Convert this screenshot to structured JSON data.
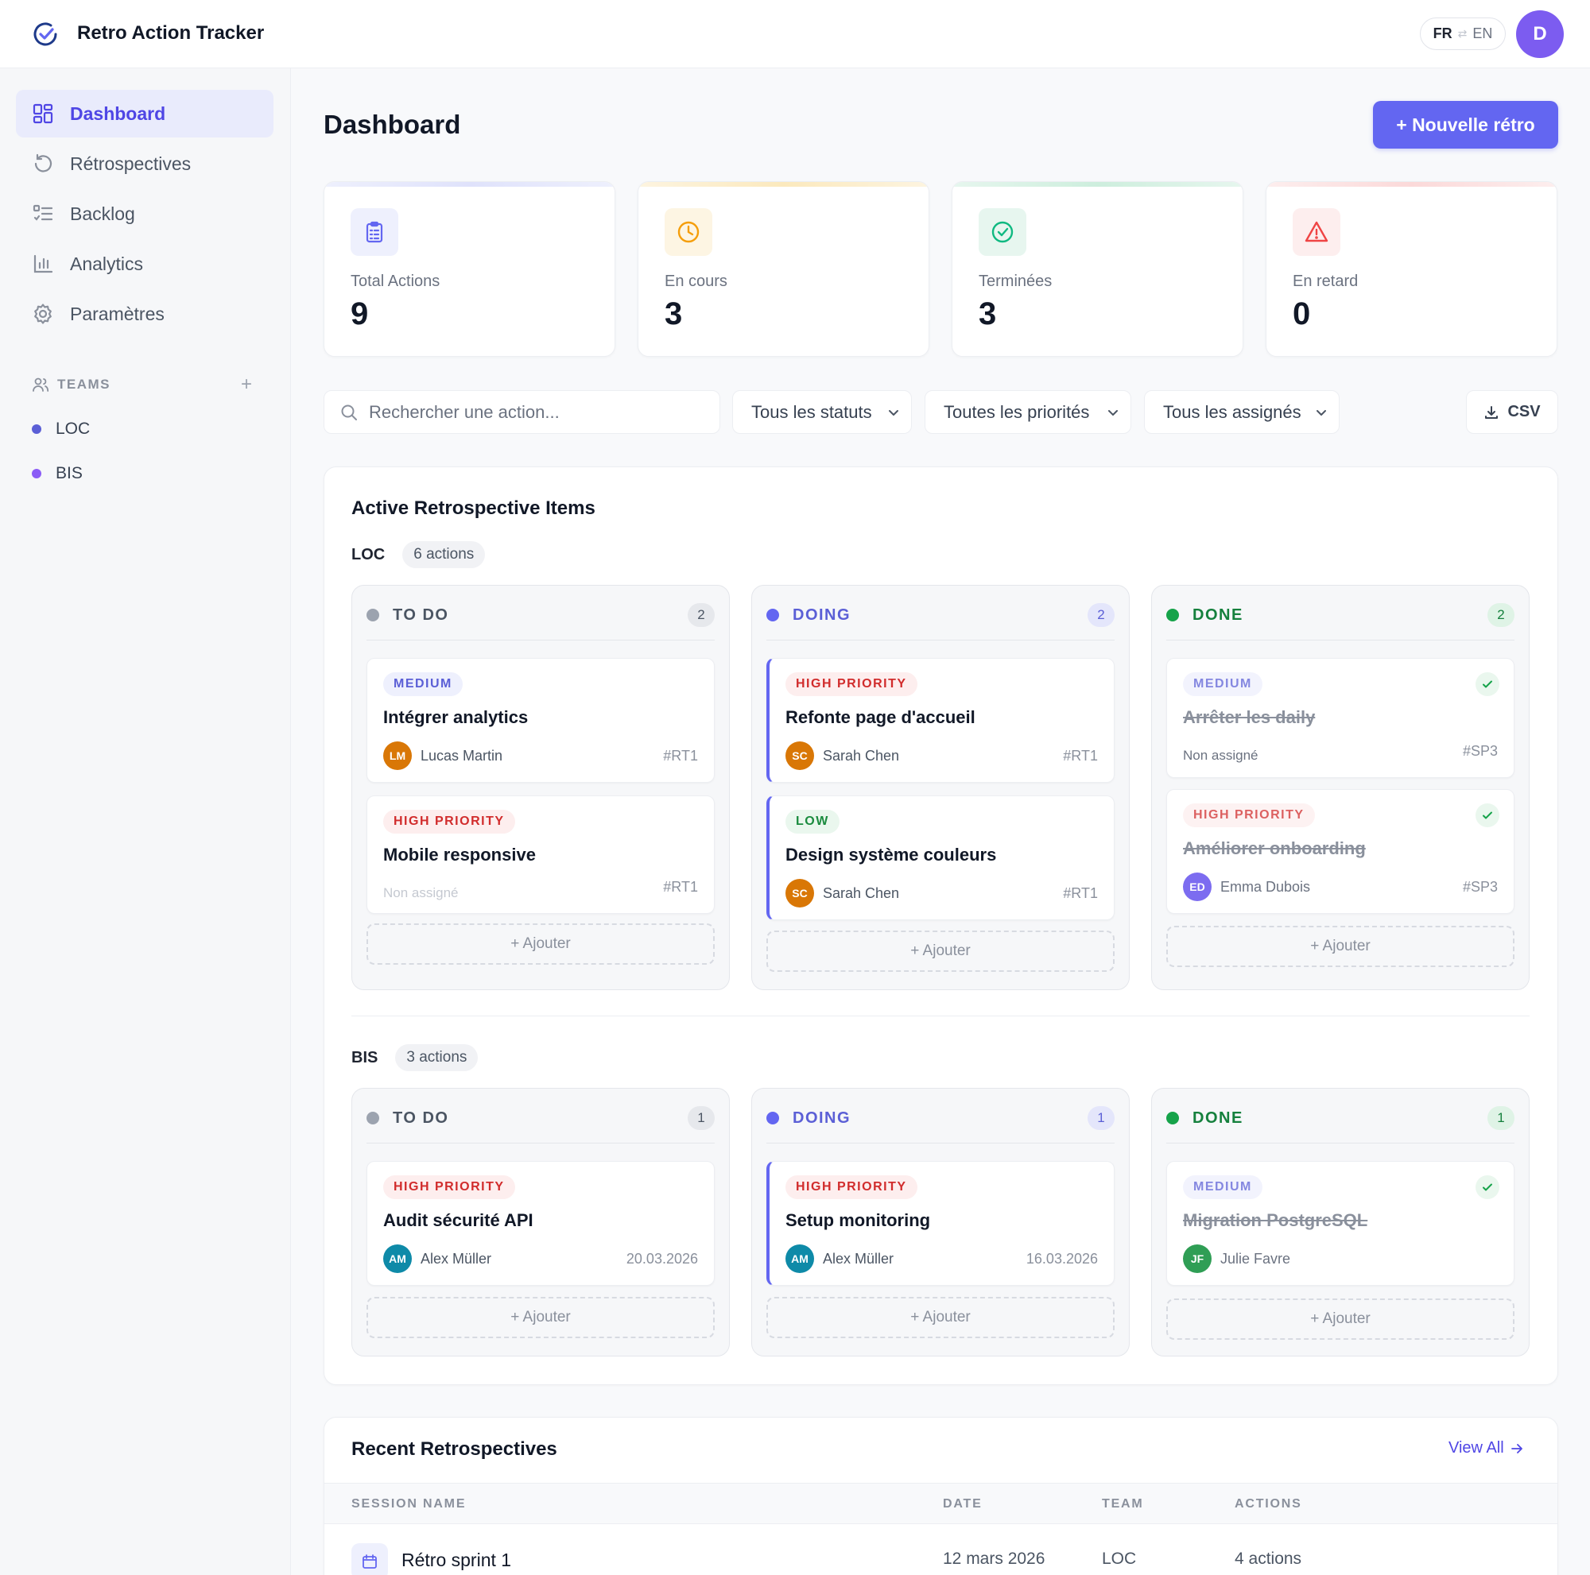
{
  "app": {
    "title": "Retro Action Tracker"
  },
  "lang": {
    "fr": "FR",
    "sep": "⇄",
    "en": "EN"
  },
  "user": {
    "initial": "D"
  },
  "sidebar": {
    "nav": [
      {
        "label": "Dashboard",
        "icon": "dashboard-icon"
      },
      {
        "label": "Rétrospectives",
        "icon": "history-icon"
      },
      {
        "label": "Backlog",
        "icon": "list-icon"
      },
      {
        "label": "Analytics",
        "icon": "bar-chart-icon"
      },
      {
        "label": "Paramètres",
        "icon": "gear-icon"
      }
    ],
    "teams_label": "TEAMS",
    "teams_add": "+",
    "teams": [
      {
        "name": "LOC",
        "color": "#5b5fd6"
      },
      {
        "name": "BIS",
        "color": "#8b5cf6"
      }
    ]
  },
  "page": {
    "title": "Dashboard",
    "new_retro_label": "+ Nouvelle rétro"
  },
  "stats": [
    {
      "label": "Total Actions",
      "value": "9",
      "color": "#6366f1",
      "icon": "clipboard-icon"
    },
    {
      "label": "En cours",
      "value": "3",
      "color": "#f59e0b",
      "icon": "clock-icon"
    },
    {
      "label": "Terminées",
      "value": "3",
      "color": "#10b981",
      "icon": "check-circle-icon"
    },
    {
      "label": "En retard",
      "value": "0",
      "color": "#ef4444",
      "icon": "warning-icon"
    }
  ],
  "filters": {
    "search_placeholder": "Rechercher une action...",
    "status": "Tous les statuts",
    "priority": "Toutes les priorités",
    "assignee": "Tous les assignés",
    "export_label": "CSV"
  },
  "active": {
    "title": "Active Retrospective Items",
    "add_label": "+ Ajouter",
    "groups": [
      {
        "team": "LOC",
        "count_label": "6 actions",
        "columns": [
          {
            "name": "TO DO",
            "count": "2",
            "cards": [
              {
                "priority": "MEDIUM",
                "title": "Intégrer analytics",
                "initials": "LM",
                "assignee": "Lucas Martin",
                "ref": "#RT1"
              },
              {
                "priority": "HIGH PRIORITY",
                "title": "Mobile responsive",
                "assignee": "Non assigné",
                "ref": "#RT1"
              }
            ]
          },
          {
            "name": "DOING",
            "count": "2",
            "cards": [
              {
                "priority": "HIGH PRIORITY",
                "title": "Refonte page d'accueil",
                "initials": "SC",
                "assignee": "Sarah Chen",
                "ref": "#RT1"
              },
              {
                "priority": "LOW",
                "title": "Design système couleurs",
                "initials": "SC",
                "assignee": "Sarah Chen",
                "ref": "#RT1"
              }
            ]
          },
          {
            "name": "DONE",
            "count": "2",
            "cards": [
              {
                "priority": "MEDIUM",
                "title": "Arrêter les daily",
                "assignee": "Non assigné",
                "ref": "#SP3"
              },
              {
                "priority": "HIGH PRIORITY",
                "title": "Améliorer onboarding",
                "initials": "ED",
                "assignee": "Emma Dubois",
                "ref": "#SP3"
              }
            ]
          }
        ]
      },
      {
        "team": "BIS",
        "count_label": "3 actions",
        "columns": [
          {
            "name": "TO DO",
            "count": "1",
            "cards": [
              {
                "priority": "HIGH PRIORITY",
                "title": "Audit sécurité API",
                "initials": "AM",
                "assignee": "Alex Müller",
                "ref": "20.03.2026"
              }
            ]
          },
          {
            "name": "DOING",
            "count": "1",
            "cards": [
              {
                "priority": "HIGH PRIORITY",
                "title": "Setup monitoring",
                "initials": "AM",
                "assignee": "Alex Müller",
                "ref": "16.03.2026"
              }
            ]
          },
          {
            "name": "DONE",
            "count": "1",
            "cards": [
              {
                "priority": "MEDIUM",
                "title": "Migration PostgreSQL",
                "initials": "JF",
                "assignee": "Julie Favre",
                "ref": ""
              }
            ]
          }
        ]
      }
    ]
  },
  "recent": {
    "title": "Recent Retrospectives",
    "view_all": "View All",
    "columns": [
      "SESSION NAME",
      "DATE",
      "TEAM",
      "ACTIONS"
    ],
    "rows": [
      {
        "name": "Rétro sprint 1",
        "date": "12 mars 2026",
        "team": "LOC",
        "actions": "4 actions"
      }
    ]
  }
}
